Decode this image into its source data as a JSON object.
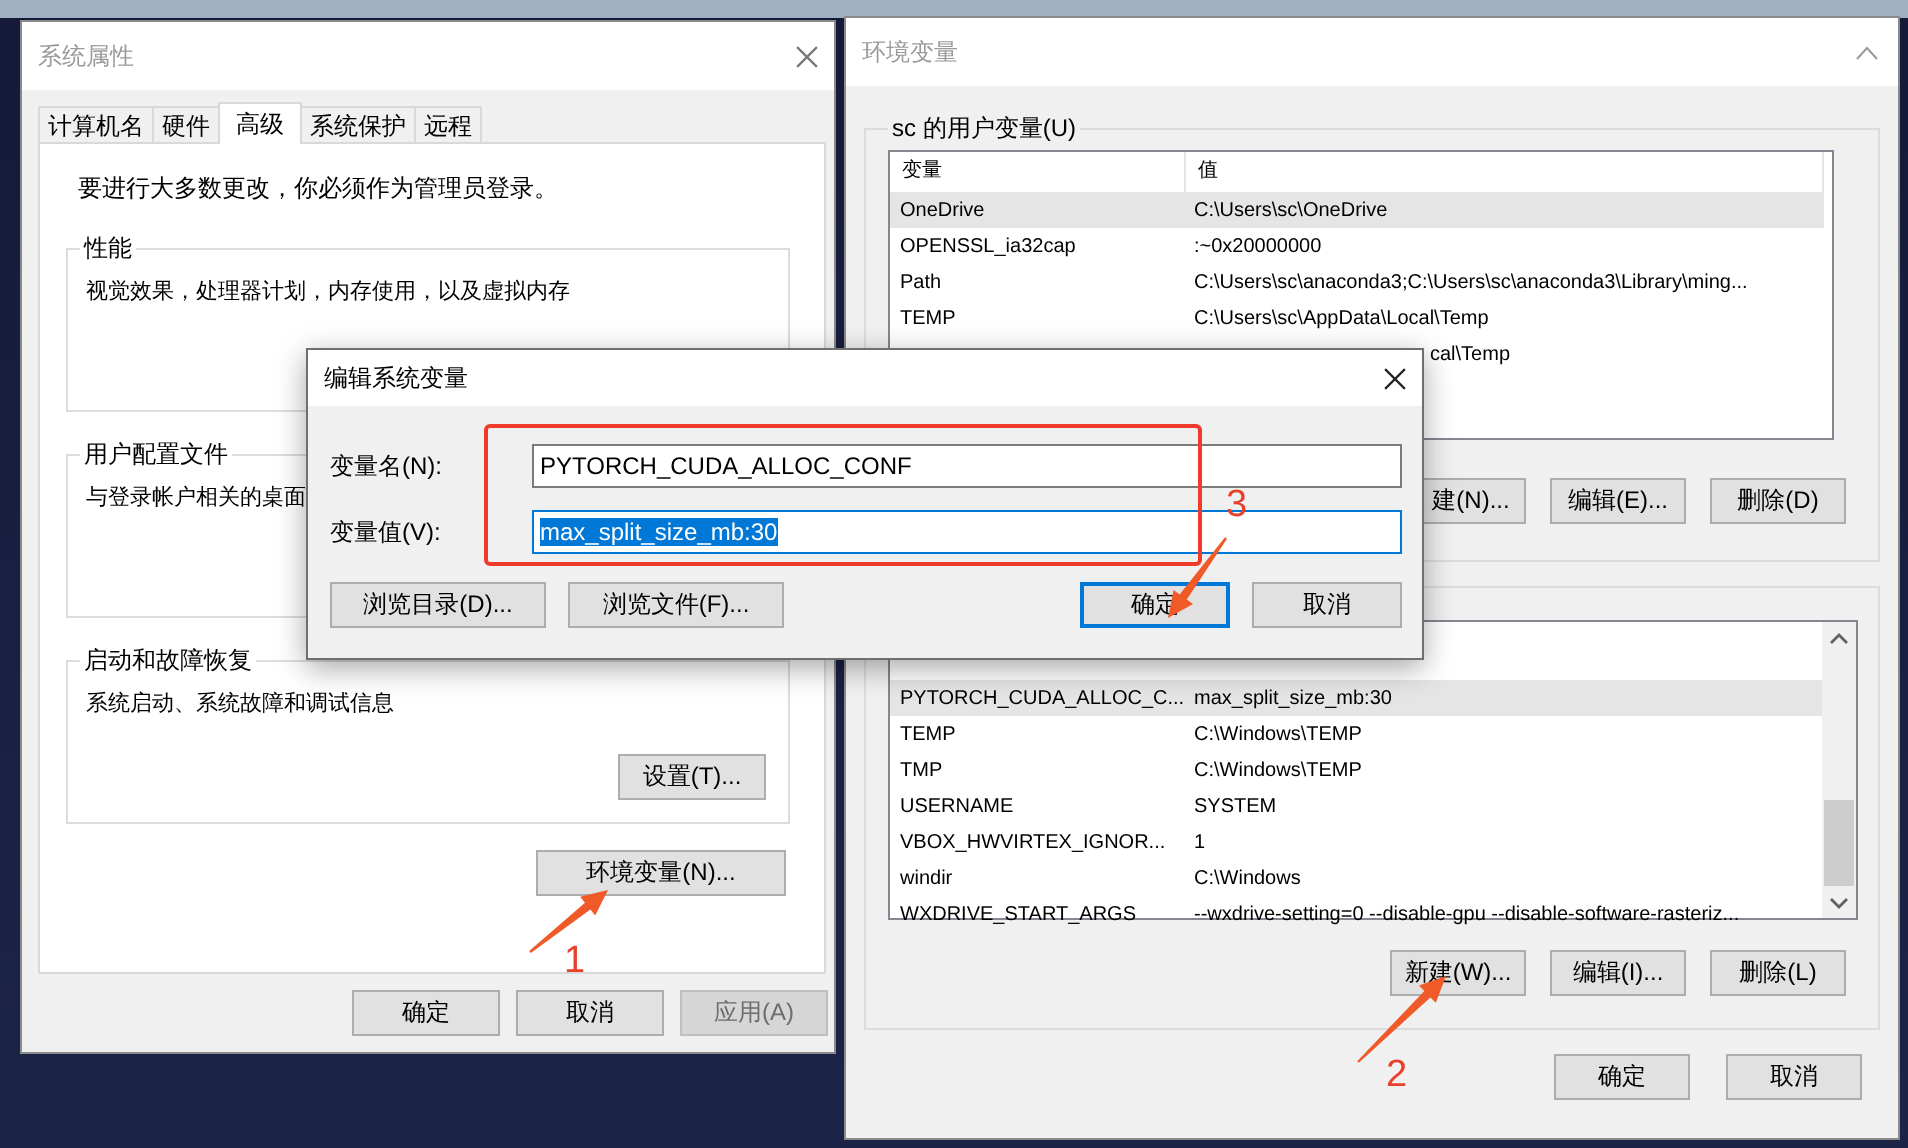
{
  "system_properties": {
    "title": "系统属性",
    "tabs": [
      {
        "label": "计算机名",
        "selected": false
      },
      {
        "label": "硬件",
        "selected": false
      },
      {
        "label": "高级",
        "selected": true
      },
      {
        "label": "系统保护",
        "selected": false
      },
      {
        "label": "远程",
        "selected": false
      }
    ],
    "admin_note": "要进行大多数更改，你必须作为管理员登录。",
    "groups": [
      {
        "title": "性能",
        "description": "视觉效果，处理器计划，内存使用，以及虚拟内存"
      },
      {
        "title": "用户配置文件",
        "description": "与登录帐户相关的桌面"
      },
      {
        "title": "启动和故障恢复",
        "description": "系统启动、系统故障和调试信息",
        "button": "设置(T)..."
      }
    ],
    "env_button": "环境变量(N)...",
    "buttons": [
      {
        "label": "确定",
        "disabled": false
      },
      {
        "label": "取消",
        "disabled": false
      },
      {
        "label": "应用(A)",
        "disabled": true
      }
    ]
  },
  "environment_variables": {
    "title": "环境变量",
    "user_vars": {
      "title": "sc 的用户变量(U)",
      "columns": [
        "变量",
        "值"
      ],
      "rows": [
        {
          "kind": "row",
          "name": "OneDrive",
          "value": "C:\\Users\\sc\\OneDrive",
          "selected": true
        },
        {
          "kind": "row",
          "name": "OPENSSL_ia32cap",
          "value": ":~0x20000000",
          "selected": false
        },
        {
          "kind": "row",
          "name": "Path",
          "value": "C:\\Users\\sc\\anaconda3;C:\\Users\\sc\\anaconda3\\Library\\ming...",
          "selected": false
        },
        {
          "kind": "row",
          "name": "TEMP",
          "value": "C:\\Users\\sc\\AppData\\Local\\Temp",
          "selected": false
        },
        {
          "kind": "partial",
          "value": "cal\\Temp",
          "selected": false
        }
      ],
      "buttons": [
        "建(N)...",
        "编辑(E)...",
        "删除(D)"
      ]
    },
    "system_vars": {
      "rows": [
        {
          "name": "PYTORCH_CUDA_ALLOC_C...",
          "value": "max_split_size_mb:30",
          "selected": true
        },
        {
          "name": "TEMP",
          "value": "C:\\Windows\\TEMP",
          "selected": false
        },
        {
          "name": "TMP",
          "value": "C:\\Windows\\TEMP",
          "selected": false
        },
        {
          "name": "USERNAME",
          "value": "SYSTEM",
          "selected": false
        },
        {
          "name": "VBOX_HWVIRTEX_IGNOR...",
          "value": "1",
          "selected": false
        },
        {
          "name": "windir",
          "value": "C:\\Windows",
          "selected": false
        },
        {
          "name": "WXDRIVE_START_ARGS",
          "value": "--wxdrive-setting=0 --disable-gpu --disable-software-rasteriz...",
          "selected": false
        }
      ],
      "buttons": [
        "新建(W)...",
        "编辑(I)...",
        "删除(L)"
      ]
    },
    "buttons": [
      "确定",
      "取消"
    ]
  },
  "edit_dialog": {
    "title": "编辑系统变量",
    "fields": [
      {
        "label": "变量名(N):",
        "value": "PYTORCH_CUDA_ALLOC_CONF",
        "focused": false
      },
      {
        "label": "变量值(V):",
        "value": "max_split_size_mb:30",
        "focused": true
      }
    ],
    "browse_buttons": [
      "浏览目录(D)...",
      "浏览文件(F)..."
    ],
    "buttons": [
      {
        "label": "确定",
        "default": true
      },
      {
        "label": "取消",
        "default": false
      }
    ]
  },
  "annotations": [
    {
      "kind": "box"
    },
    {
      "kind": "arrow",
      "label": "1"
    },
    {
      "kind": "arrow",
      "label": "2"
    },
    {
      "kind": "arrow",
      "label": "3"
    }
  ]
}
